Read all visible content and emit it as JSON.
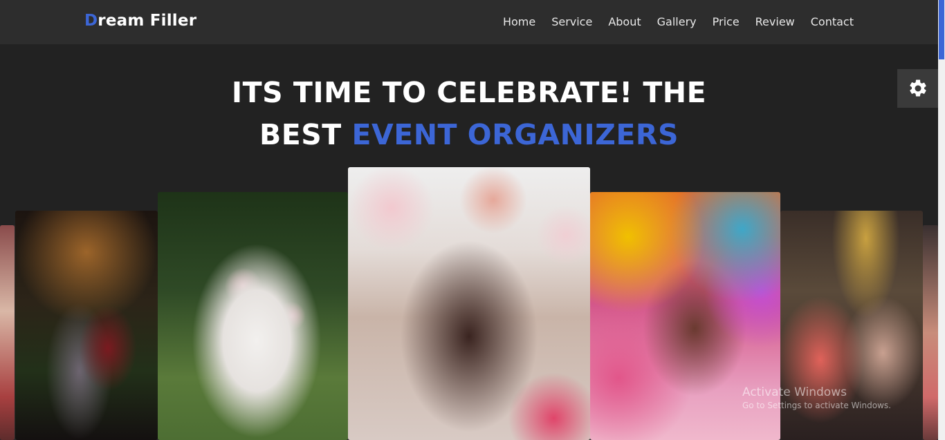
{
  "brand": {
    "first_letter": "D",
    "rest": "ream Filler"
  },
  "nav": {
    "items": [
      "Home",
      "Service",
      "About",
      "Gallery",
      "Price",
      "Review",
      "Contact"
    ]
  },
  "hero": {
    "line1": "ITS TIME TO CELEBRATE! THE",
    "line2_plain": "BEST ",
    "line2_accent": "EVENT ORGANIZERS"
  },
  "settings": {
    "icon": "gear-icon"
  },
  "gallery": {
    "cards": [
      {
        "name": "wedding-couple-photo"
      },
      {
        "name": "baby-teepee-photo"
      },
      {
        "name": "party-balloons-photo"
      },
      {
        "name": "holi-colors-photo"
      },
      {
        "name": "birthday-celebration-photo"
      }
    ]
  },
  "watermark": {
    "title": "Activate Windows",
    "subtitle": "Go to Settings to activate Windows."
  },
  "colors": {
    "accent": "#3c66d6",
    "nav_bg": "#2d2d2d",
    "page_bg": "#222222"
  }
}
